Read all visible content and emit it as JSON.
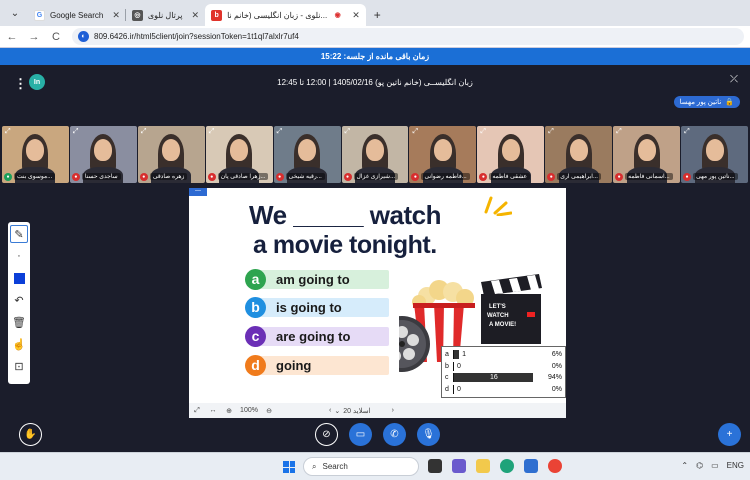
{
  "browser": {
    "tabs": [
      {
        "label": "Google Search",
        "favicon": "google-icon",
        "active": false
      },
      {
        "label": "پرتال نلوی",
        "favicon": "globe-icon",
        "active": false
      },
      {
        "label": "نلوی - زبان انگلیسی (خانم نا...",
        "favicon": "bbb-icon",
        "active": true
      }
    ],
    "url": "809.6426.ir/html5client/join?sessionToken=1t1ql7alxlr7uf4"
  },
  "banner": {
    "text": "زمان باقی مانده از جلسه: 15:22"
  },
  "header": {
    "title": "زبان انگلیســی (خانم ناتین پو) 1405/02/16 | 12:00 تا 12:45",
    "logo_text": "In",
    "presenter_pill": "ناتین پور مهسا"
  },
  "webcams": [
    {
      "name": "موسوی بنت..."
    },
    {
      "name": "ساجدی حسنا"
    },
    {
      "name": "زهره صادقی"
    },
    {
      "name": "زهرا صادقی پان..."
    },
    {
      "name": "رقیه شیخی..."
    },
    {
      "name": "شیرازی غزال..."
    },
    {
      "name": "فاطمه رضوانی..."
    },
    {
      "name": "عشقی فاطمه"
    },
    {
      "name": "ابراهیمی آری..."
    },
    {
      "name": "آسمانی فاطمه..."
    },
    {
      "name": "ناتین پور مهی..."
    }
  ],
  "slide": {
    "corner_label": "—",
    "line1": "We _____ watch",
    "line2": "a movie tonight.",
    "options": [
      {
        "letter": "a",
        "text": "am going to",
        "color": "#2ea44f",
        "bar": "#d7f0dc"
      },
      {
        "letter": "b",
        "text": "is going to",
        "color": "#1f8fe0",
        "bar": "#d6ecfb"
      },
      {
        "letter": "c",
        "text": "are going to",
        "color": "#6b2fb6",
        "bar": "#e6dbf6"
      },
      {
        "letter": "d",
        "text": "going",
        "color": "#f07b1c",
        "bar": "#fde6d2"
      }
    ],
    "board_text": "LET'S WATCH A MOVIE!",
    "slide_label": "اسلاید 20",
    "zoom": "100%"
  },
  "poll": {
    "rows": [
      {
        "label": "a",
        "count": "1",
        "percent": "6%",
        "fraction": 0.06
      },
      {
        "label": "b",
        "count": "0",
        "percent": "0%",
        "fraction": 0
      },
      {
        "label": "c",
        "count": "16",
        "percent": "94%",
        "fraction": 0.94
      },
      {
        "label": "d",
        "count": "0",
        "percent": "0%",
        "fraction": 0
      }
    ]
  },
  "taskbar": {
    "search_placeholder": "Search",
    "lang": "ENG"
  },
  "colors": {
    "accent": "#1b6fd6",
    "app_bg": "#1b1d2b"
  }
}
